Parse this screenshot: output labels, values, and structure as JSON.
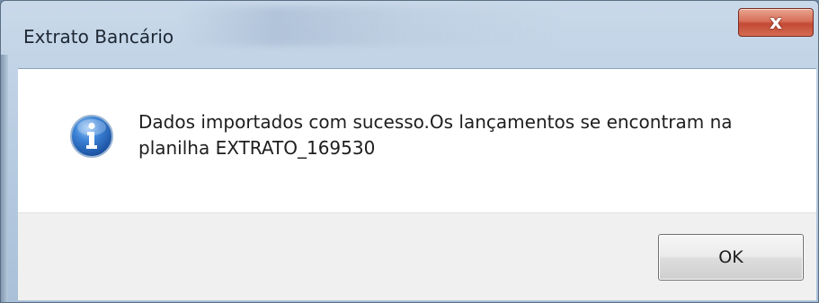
{
  "window": {
    "title": "Extrato Bancário",
    "close_label": "x"
  },
  "dialog": {
    "icon": "information-icon",
    "message_line1": "Dados importados com sucesso.Os lançamentos se encontram na",
    "message_line2": "planilha EXTRATO_169530"
  },
  "buttons": {
    "ok_label": "OK"
  },
  "colors": {
    "titlebar": "#b9cde2",
    "close_button": "#c94b35",
    "icon_blue": "#1f5fb8",
    "footer": "#f0f0f0"
  }
}
